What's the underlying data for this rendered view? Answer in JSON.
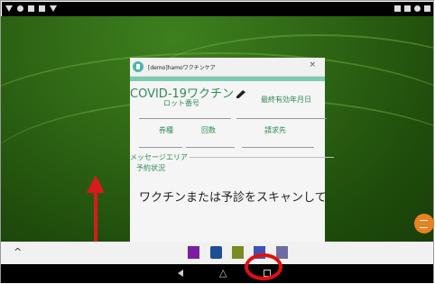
{
  "dialog": {
    "title": "[demo]hamoワクチンケア",
    "close_label": "×"
  },
  "form": {
    "vaccine_title": "COVID-19ワクチン",
    "lot_label": "ロット番号",
    "expiry_label": "最終有効年月日",
    "ticket_label": "券種",
    "count_label": "回数",
    "billing_label": "請求先",
    "message_area_label": "メッセージエリア",
    "reservation_label": "予約状況",
    "scan_message": "ワクチンまたは予診をスキャンして"
  },
  "taskbar": {
    "caret": "^"
  },
  "navbar": {
    "home": "△"
  },
  "colors": {
    "accent_green": "#2e8b57",
    "fab_orange": "#e8811f",
    "annotation_red": "#d81b1b"
  }
}
